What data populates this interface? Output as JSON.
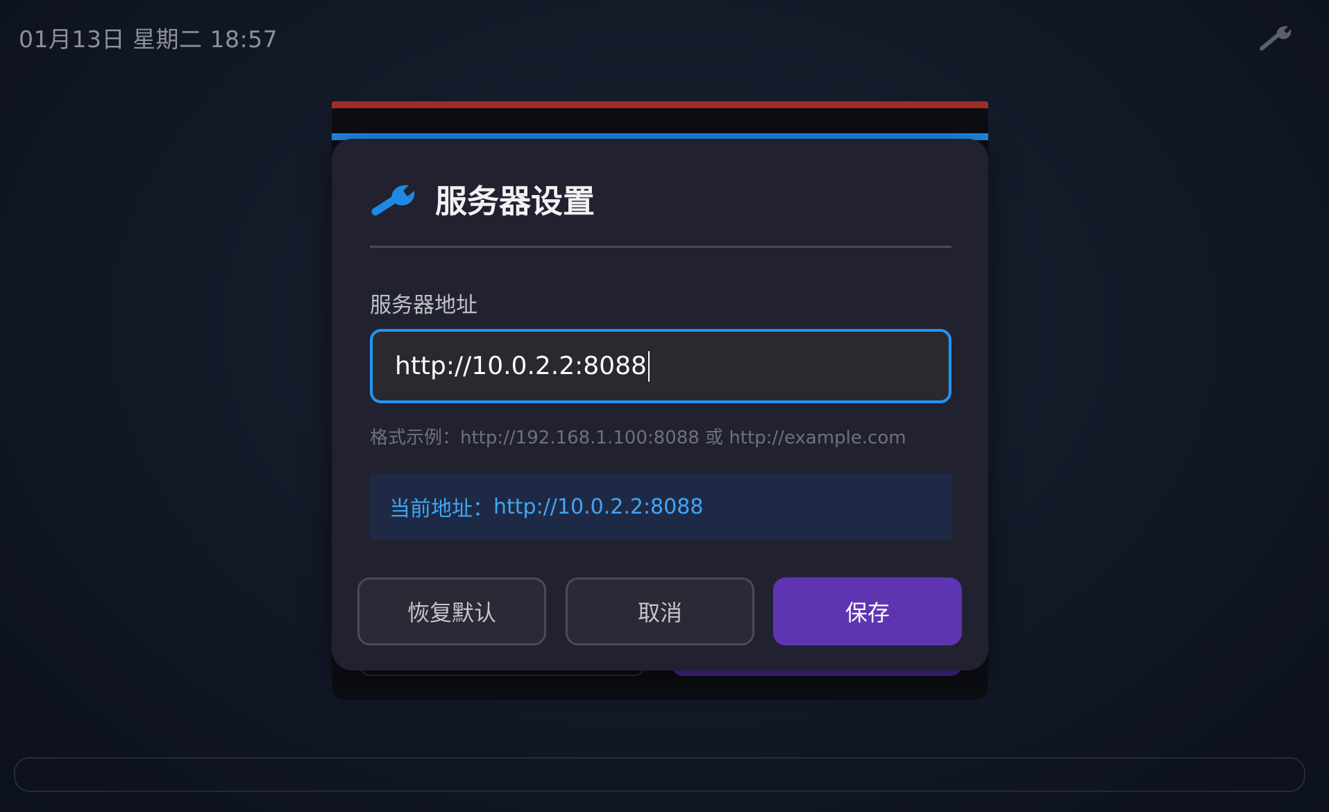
{
  "status_bar": {
    "datetime": "01月13日 星期二 18:57",
    "settings_icon": "wrench-icon"
  },
  "dialog": {
    "title": "服务器设置",
    "title_icon": "wrench-icon",
    "field_label": "服务器地址",
    "input_value": "http://10.0.2.2:8088",
    "hint": "格式示例：http://192.168.1.100:8088 或 http://example.com",
    "current_address_label": "当前地址：",
    "current_address_value": "http://10.0.2.2:8088",
    "buttons": {
      "reset": "恢复默认",
      "cancel": "取消",
      "save": "保存"
    }
  },
  "colors": {
    "accent_blue": "#2196f3",
    "save_purple": "#5e35b1",
    "current_address_text": "#42a5f5"
  }
}
